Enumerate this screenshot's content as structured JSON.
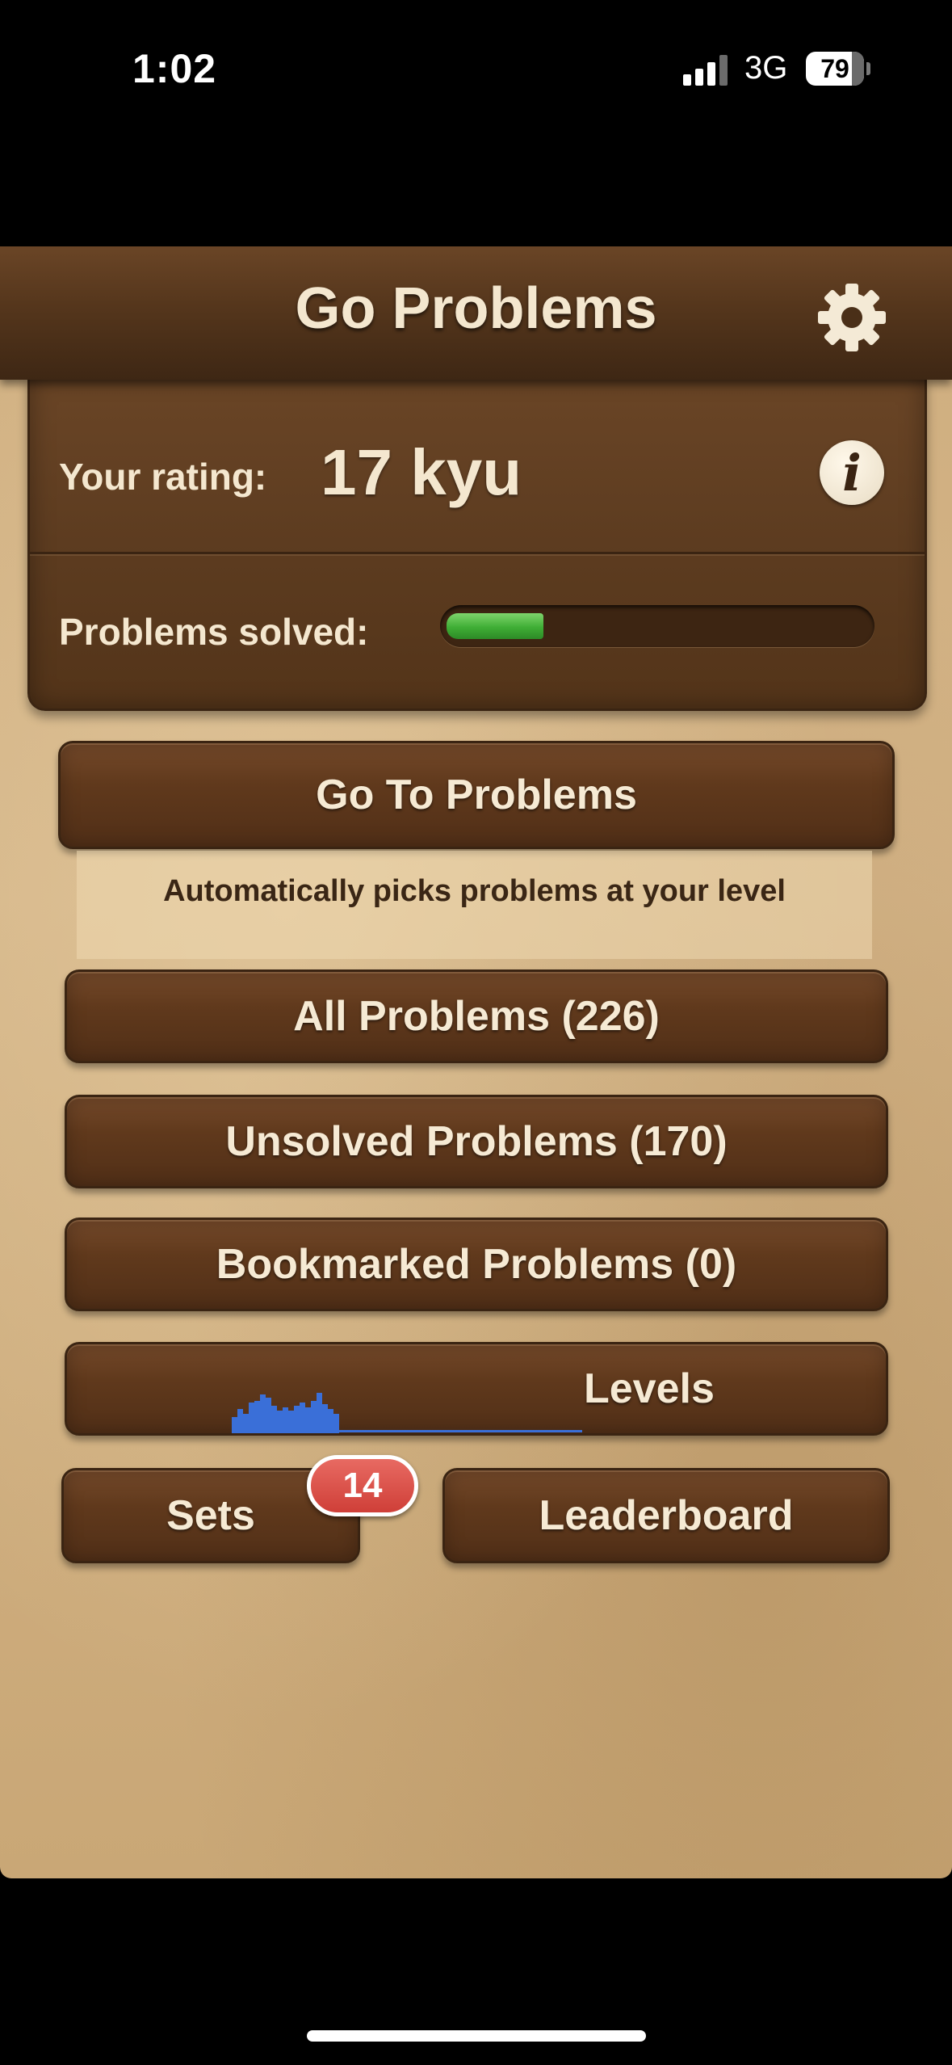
{
  "status_bar": {
    "time": "1:02",
    "network": "3G",
    "battery_percent": "79",
    "battery_level": 0.79,
    "signal_bars": 3
  },
  "header": {
    "title": "Go Problems",
    "settings_icon": "gear-icon"
  },
  "rating": {
    "label": "Your rating:",
    "value": "17 kyu",
    "info_icon": "info-icon",
    "info_glyph": "i"
  },
  "progress": {
    "label": "Problems solved:",
    "fraction": 0.23,
    "color": "#3fae35"
  },
  "buttons": {
    "go_to_problems": "Go To Problems",
    "auto_note": "Automatically picks problems at your level",
    "all_problems": "All Problems (226)",
    "unsolved_problems": "Unsolved Problems (170)",
    "bookmarked_problems": "Bookmarked Problems (0)",
    "levels": "Levels",
    "sets": "Sets",
    "sets_badge": "14",
    "leaderboard": "Leaderboard"
  },
  "colors": {
    "wood_dark": "#55361c",
    "parchment": "#d4b487",
    "text_light": "#f4e7cf",
    "badge_red": "#cf3f38",
    "levels_graph_blue": "#3a6fd8"
  }
}
